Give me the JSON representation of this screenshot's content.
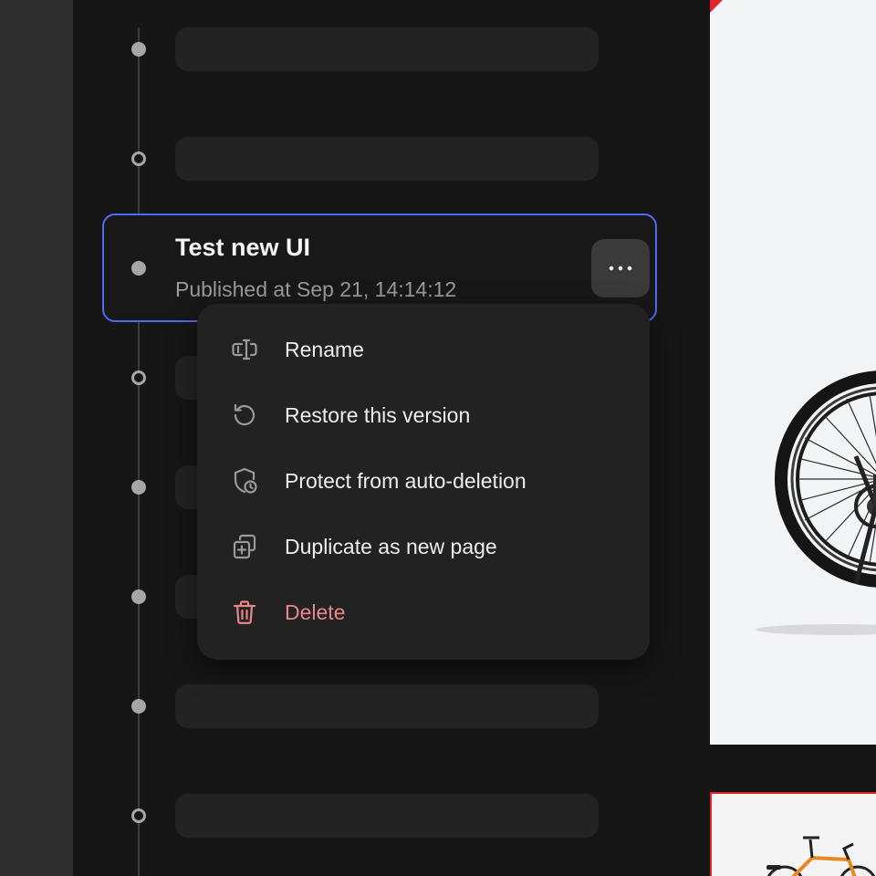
{
  "version": {
    "title": "Test new UI",
    "subtitle": "Published at Sep 21, 14:14:12"
  },
  "context_menu": {
    "items": [
      {
        "label": "Rename",
        "icon": "rename-icon"
      },
      {
        "label": "Restore this version",
        "icon": "restore-icon"
      },
      {
        "label": "Protect from auto-deletion",
        "icon": "shield-clock-icon"
      },
      {
        "label": "Duplicate as new page",
        "icon": "duplicate-icon"
      },
      {
        "label": "Delete",
        "icon": "trash-icon",
        "danger": true
      }
    ]
  },
  "colors": {
    "accent": "#4a6cf7",
    "danger": "#e8868a",
    "brand_red": "#e0262c",
    "bike_orange": "#e8891f"
  }
}
